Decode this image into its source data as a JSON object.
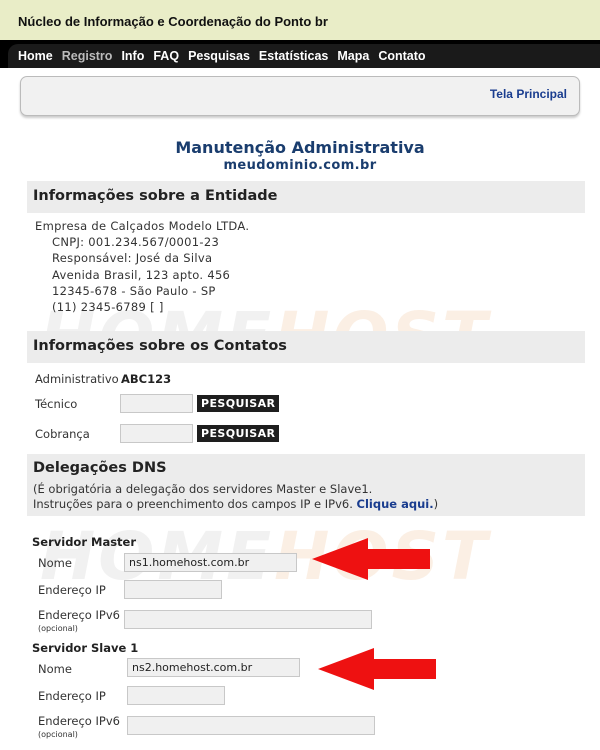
{
  "header": {
    "org_title": "Núcleo de Informação e Coordenação do Ponto br"
  },
  "nav": {
    "items": [
      {
        "label": "Home"
      },
      {
        "label": "Registro"
      },
      {
        "label": "Info"
      },
      {
        "label": "FAQ"
      },
      {
        "label": "Pesquisas"
      },
      {
        "label": "Estatísticas"
      },
      {
        "label": "Mapa"
      },
      {
        "label": "Contato"
      }
    ]
  },
  "panel": {
    "link_label": "Tela Principal"
  },
  "page": {
    "title": "Manutenção Administrativa",
    "domain": "meudominio.com.br"
  },
  "watermark": {
    "part1": "HOME",
    "part2": "HOST"
  },
  "entity": {
    "heading": "Informações sobre a Entidade",
    "name": "Empresa de Calçados Modelo LTDA.",
    "cnpj": "CNPJ: 001.234.567/0001-23",
    "responsible": "Responsável: José da Silva",
    "address": "Avenida Brasil, 123 apto. 456",
    "city": "12345-678 - São Paulo - SP",
    "phone": "(11) 2345-6789 [ ]"
  },
  "contacts": {
    "heading": "Informações sobre os Contatos",
    "admin_label": "Administrativo",
    "admin_value": "ABC123",
    "tech_label": "Técnico",
    "tech_value": "",
    "billing_label": "Cobrança",
    "billing_value": "",
    "search_button": "PESQUISAR"
  },
  "dns": {
    "heading": "Delegações DNS",
    "note_line1": "(É obrigatória a delegação dos servidores Master e Slave1.",
    "note_line2_prefix": "Instruções para o preenchimento dos campos IP e IPv6. ",
    "note_link": "Clique aqui.",
    "note_suffix": ")",
    "master": {
      "title": "Servidor Master",
      "name_label": "Nome",
      "name_value": "ns1.homehost.com.br",
      "ip_label": "Endereço IP",
      "ip_value": "",
      "ipv6_label": "Endereço IPv6",
      "ipv6_value": "",
      "optional": "(opcional)"
    },
    "slave": {
      "title": "Servidor Slave 1",
      "name_label": "Nome",
      "name_value": "ns2.homehost.com.br",
      "ip_label": "Endereço IP",
      "ip_value": "",
      "ipv6_label": "Endereço IPv6",
      "ipv6_value": "",
      "optional": "(opcional)"
    }
  },
  "colors": {
    "accent_arrow": "#ee1111",
    "heading_blue": "#1a3d6e",
    "nav_bg": "#000000",
    "topbar_bg": "#e9edc7"
  }
}
